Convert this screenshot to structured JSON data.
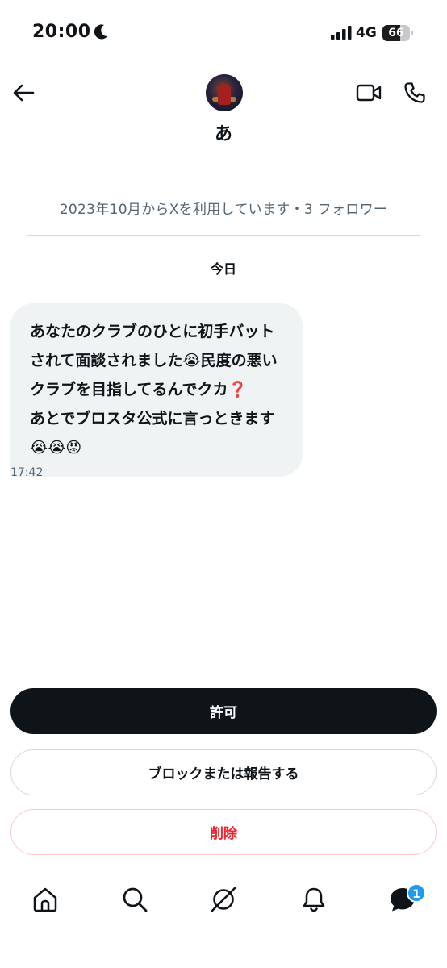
{
  "status_bar": {
    "time": "20:00",
    "network": "4G",
    "battery_text": "66",
    "battery_level": 0.66
  },
  "header": {
    "name": "あ",
    "back_icon": "arrow-left-icon",
    "video_icon": "video-camera-icon",
    "call_icon": "phone-icon"
  },
  "profile_info": "2023年10月からXを利用しています・3 フォロワー",
  "date_label": "今日",
  "message": {
    "text": "あなたのクラブのひとに初手バットされて面談されました😭民度の悪いクラブを目指してるんでクカ❓\nあとでブロスタ公式に言っときます😭😭😡",
    "time": "17:42"
  },
  "actions": {
    "allow": "許可",
    "block_report": "ブロックまたは報告する",
    "delete": "削除"
  },
  "tabbar": {
    "items": [
      "home-icon",
      "search-icon",
      "grok-icon",
      "notifications-bell-icon",
      "messages-icon"
    ],
    "messages_badge": "1"
  },
  "colors": {
    "text_primary": "#0f1419",
    "text_secondary": "#536471",
    "accent_blue": "#1d9bf0",
    "danger_red": "#f4212e"
  }
}
